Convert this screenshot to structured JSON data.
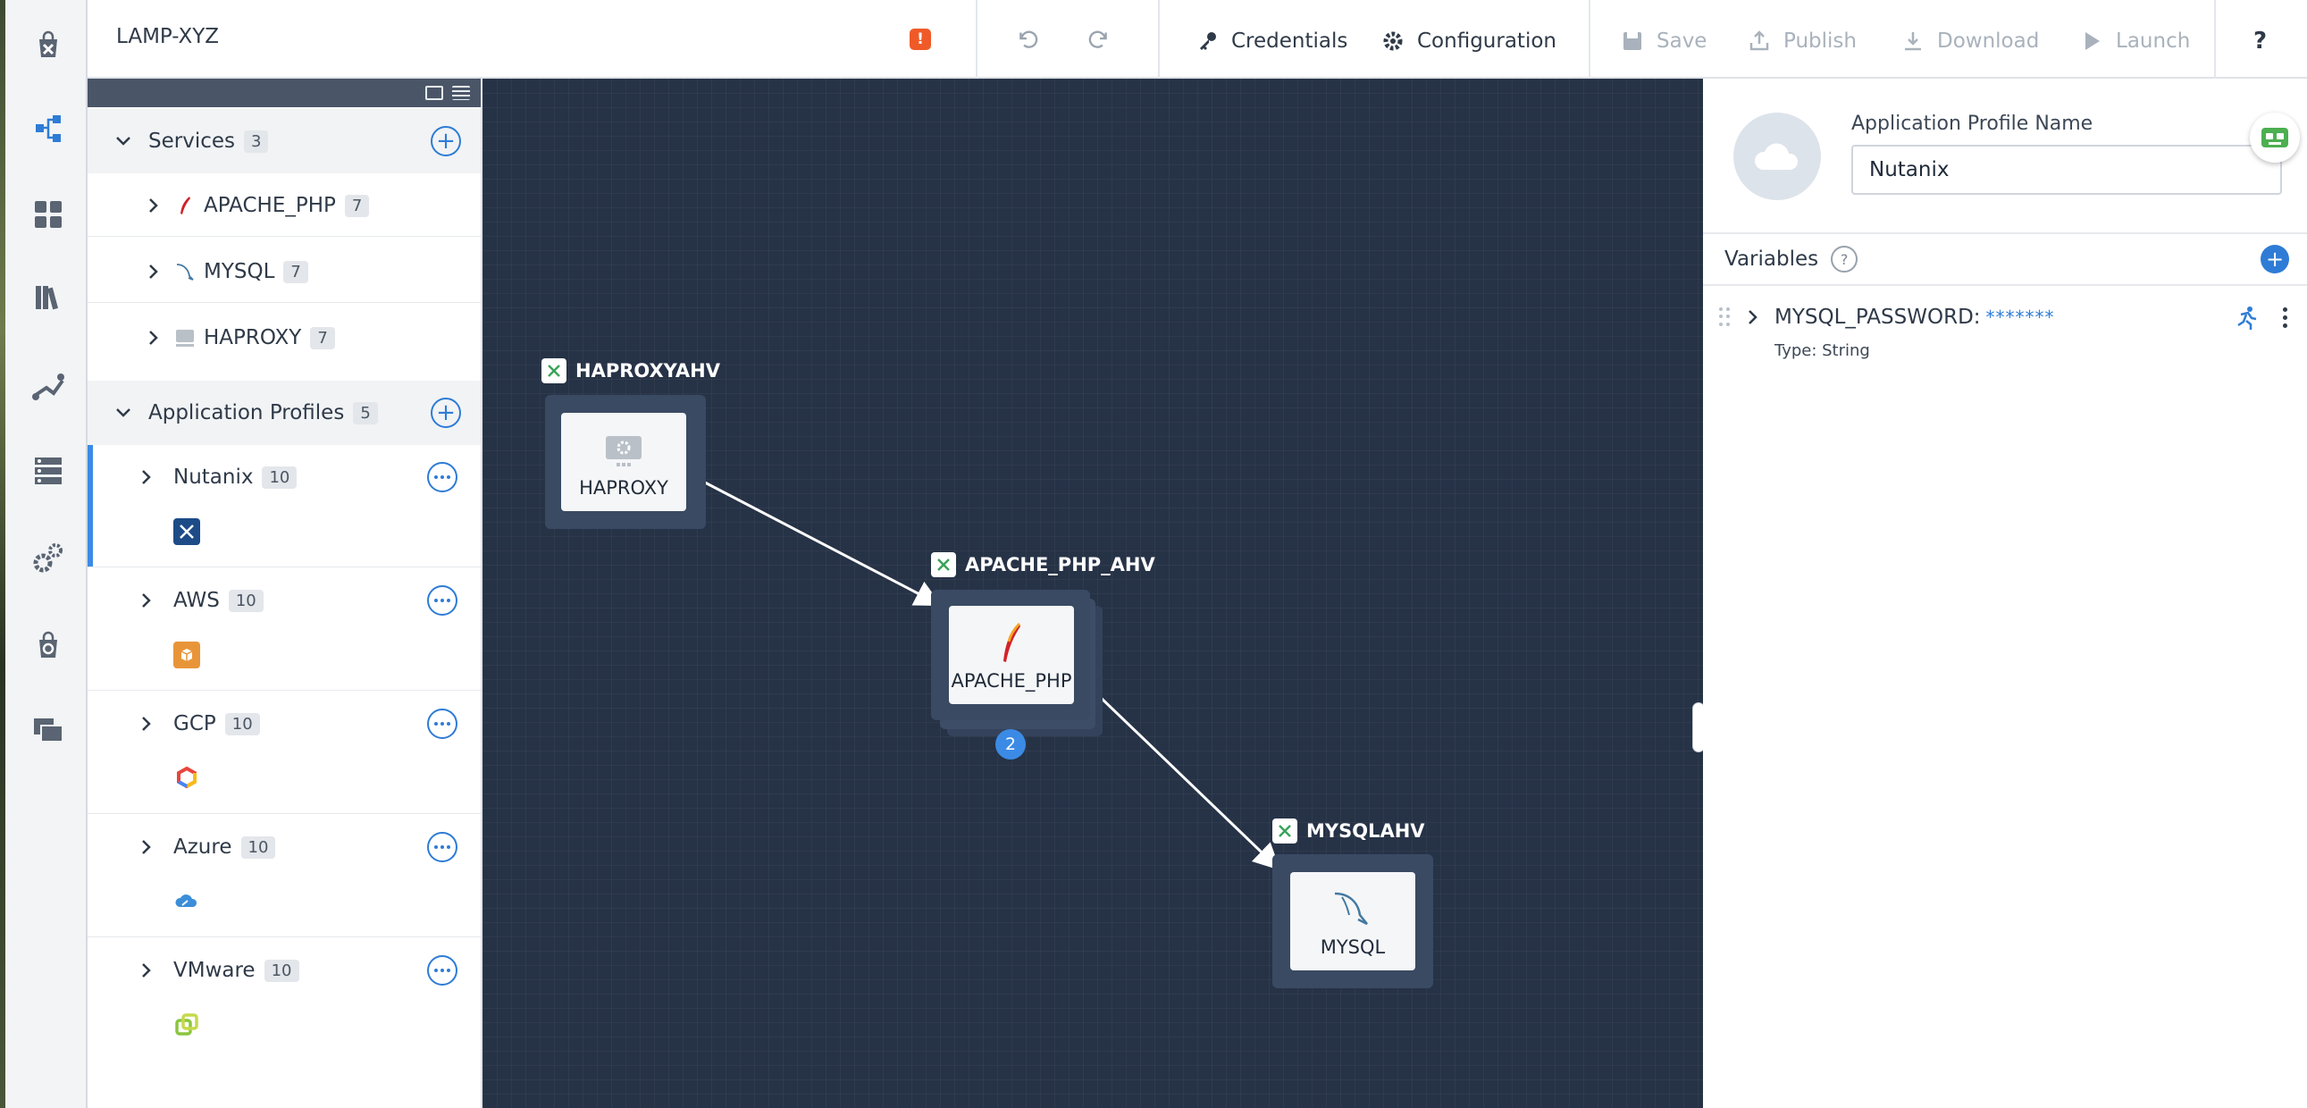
{
  "app": {
    "title": "LAMP-XYZ"
  },
  "toolbar": {
    "credentials": "Credentials",
    "configuration": "Configuration",
    "save": "Save",
    "publish": "Publish",
    "download": "Download",
    "launch": "Launch",
    "help": "?",
    "alert": "!"
  },
  "rail": [
    "marketplace-icon",
    "blueprints-icon",
    "dashboard-icon",
    "library-icon",
    "runbooks-icon",
    "endpoints-icon",
    "settings-icon",
    "marketplace-manager-icon",
    "projects-icon"
  ],
  "tree": {
    "services": {
      "label": "Services",
      "count": "3",
      "items": [
        {
          "label": "APACHE_PHP",
          "count": "7"
        },
        {
          "label": "MYSQL",
          "count": "7"
        },
        {
          "label": "HAPROXY",
          "count": "7"
        }
      ]
    },
    "profiles": {
      "label": "Application Profiles",
      "count": "5",
      "items": [
        {
          "label": "Nutanix",
          "count": "10",
          "color": "#1c4b87"
        },
        {
          "label": "AWS",
          "count": "10",
          "color": "#e8953a"
        },
        {
          "label": "GCP",
          "count": "10",
          "color": "#e8453c"
        },
        {
          "label": "Azure",
          "count": "10",
          "color": "#3b8ed8"
        },
        {
          "label": "VMware",
          "count": "10",
          "color": "#8bc53f"
        }
      ]
    }
  },
  "canvas": {
    "nodes": [
      {
        "substrate": "HAPROXYAHV",
        "service": "HAPROXY"
      },
      {
        "substrate": "APACHE_PHP_AHV",
        "service": "APACHE_PHP",
        "replicas": "2"
      },
      {
        "substrate": "MYSQLAHV",
        "service": "MYSQL"
      }
    ]
  },
  "panel": {
    "profile_name_label": "Application Profile Name",
    "profile_name_value": "Nutanix",
    "variables_title": "Variables",
    "help": "?",
    "variable": {
      "name": "MYSQL_PASSWORD:",
      "value": "*******",
      "type": "Type: String"
    }
  }
}
